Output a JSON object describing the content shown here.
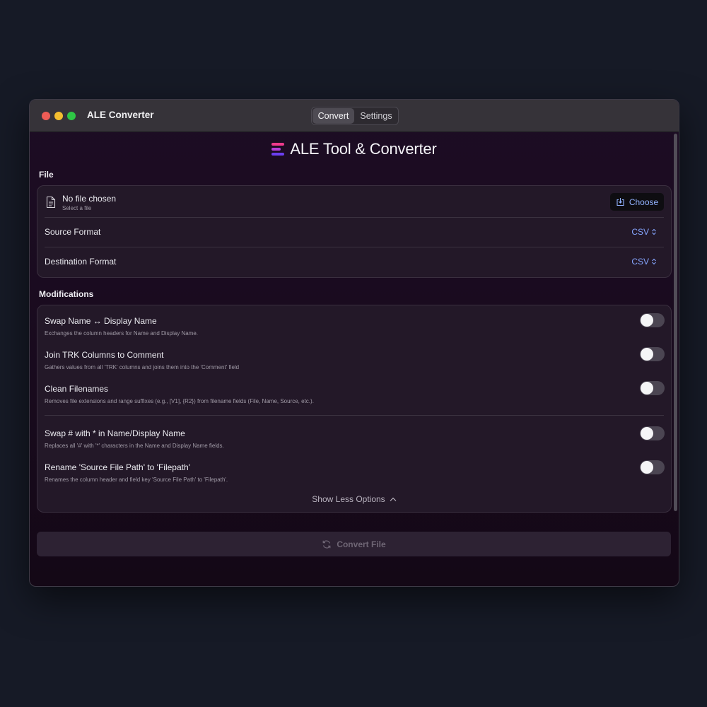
{
  "window": {
    "title": "ALE Converter"
  },
  "tabs": [
    {
      "label": "Convert",
      "selected": true
    },
    {
      "label": "Settings",
      "selected": false
    }
  ],
  "header": {
    "title": "ALE Tool & Converter",
    "logo_colors": [
      "#ee3a8c",
      "#b43fd8",
      "#6b3ff0"
    ]
  },
  "file_section": {
    "label": "File",
    "file": {
      "name": "No file chosen",
      "hint": "Select a file",
      "icon": "document-icon"
    },
    "choose_button": {
      "label": "Choose",
      "icon": "import-icon"
    },
    "source_format": {
      "label": "Source Format",
      "value": "CSV"
    },
    "destination_format": {
      "label": "Destination Format",
      "value": "CSV"
    }
  },
  "modifications": {
    "label": "Modifications",
    "options": [
      {
        "title": "Swap Name ↔ Display Name",
        "description": "Exchanges the column headers for Name and Display Name.",
        "enabled": false
      },
      {
        "title": "Join TRK Columns to Comment",
        "description": "Gathers values from all 'TRK' columns and joins them into the 'Comment' field",
        "enabled": false
      },
      {
        "title": "Clean Filenames",
        "description": "Removes file extensions and range suffixes (e.g., [V1], {R2}) from filename fields (File, Name, Source, etc.).",
        "enabled": false
      },
      {
        "title": "Swap # with * in Name/Display Name",
        "description": "Replaces all '#' with '*' characters in the Name and Display Name fields.",
        "enabled": false
      },
      {
        "title": "Rename 'Source File Path' to 'Filepath'",
        "description": "Renames the column header and field key 'Source File Path' to 'Filepath'.",
        "enabled": false
      }
    ],
    "show_less_label": "Show Less Options"
  },
  "convert_button": {
    "label": "Convert File",
    "icon": "refresh-icon",
    "enabled": false
  },
  "colors": {
    "accent": "#86a6ff",
    "background": "#1b0c21",
    "card": "#231828"
  }
}
